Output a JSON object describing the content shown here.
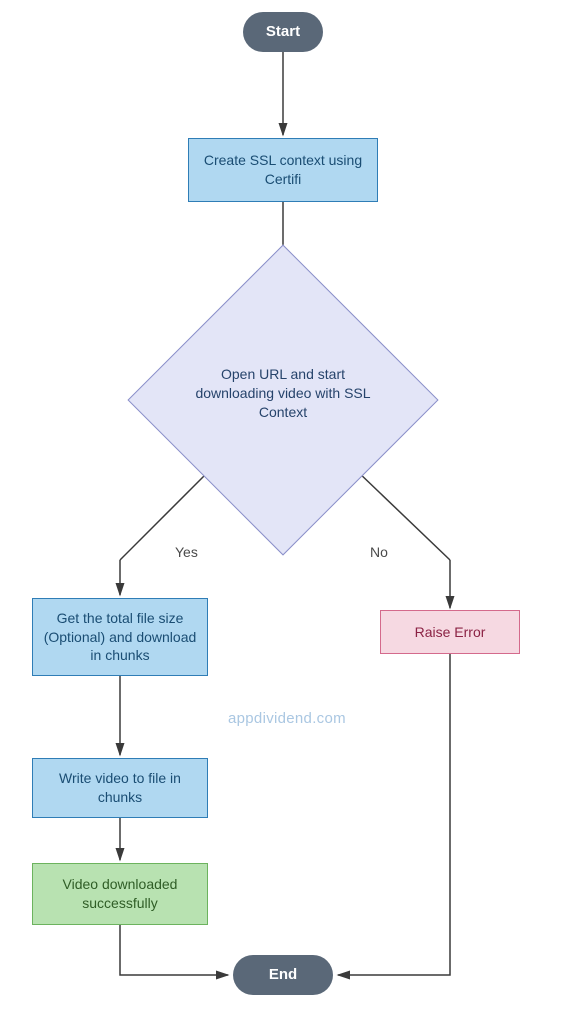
{
  "chart_data": {
    "type": "flowchart",
    "title": "",
    "nodes": [
      {
        "id": "start",
        "type": "terminal",
        "label": "Start"
      },
      {
        "id": "n1",
        "type": "process",
        "label": "Create SSL context using Certifi"
      },
      {
        "id": "n2",
        "type": "decision",
        "label": "Open URL and start downloading video with SSL Context"
      },
      {
        "id": "n3",
        "type": "process",
        "label": "Get the total file size (Optional) and download in chunks"
      },
      {
        "id": "n4",
        "type": "process",
        "label": "Write video to file in chunks"
      },
      {
        "id": "n5",
        "type": "process",
        "label": "Video downloaded successfully"
      },
      {
        "id": "n6",
        "type": "process",
        "label": "Raise Error"
      },
      {
        "id": "end",
        "type": "terminal",
        "label": "End"
      }
    ],
    "edges": [
      {
        "from": "start",
        "to": "n1",
        "label": ""
      },
      {
        "from": "n1",
        "to": "n2",
        "label": ""
      },
      {
        "from": "n2",
        "to": "n3",
        "label": "Yes"
      },
      {
        "from": "n2",
        "to": "n6",
        "label": "No"
      },
      {
        "from": "n3",
        "to": "n4",
        "label": ""
      },
      {
        "from": "n4",
        "to": "n5",
        "label": ""
      },
      {
        "from": "n5",
        "to": "end",
        "label": ""
      },
      {
        "from": "n6",
        "to": "end",
        "label": ""
      }
    ]
  },
  "labels": {
    "start": "Start",
    "n1": "Create SSL context using Certifi",
    "n2": "Open URL and start downloading video with SSL Context",
    "n3": "Get the total file size (Optional) and download in chunks",
    "n4": "Write video to file in chunks",
    "n5": "Video downloaded successfully",
    "n6": "Raise Error",
    "end": "End",
    "yes": "Yes",
    "no": "No"
  },
  "watermark": "appdividend.com",
  "colors": {
    "terminal_bg": "#5a6878",
    "process_bg": "#b0d8f1",
    "process_border": "#2f7db6",
    "decision_bg": "#e3e5f7",
    "decision_border": "#8a8fc9",
    "error_bg": "#f6d9e2",
    "error_border": "#d46a8c",
    "success_bg": "#b8e2b1",
    "success_border": "#6cb35e",
    "text": "#26436b"
  }
}
